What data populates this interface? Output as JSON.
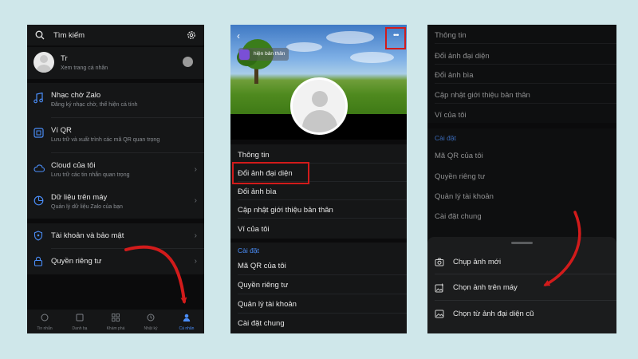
{
  "phone1": {
    "search_label": "Tìm kiếm",
    "profile": {
      "name": "Tr",
      "subtitle": "Xem trang cá nhân"
    },
    "items": [
      {
        "title": "Nhạc chờ Zalo",
        "subtitle": "Đăng ký nhạc chờ, thể hiện cá tính",
        "icon": "music-icon"
      },
      {
        "title": "Ví QR",
        "subtitle": "Lưu trữ và xuất trình các mã QR quan trọng",
        "icon": "qr-wallet-icon"
      },
      {
        "title": "Cloud của tôi",
        "subtitle": "Lưu trữ các tin nhắn quan trọng",
        "icon": "cloud-icon"
      },
      {
        "title": "Dữ liệu trên máy",
        "subtitle": "Quản lý dữ liệu Zalo của bạn",
        "icon": "pie-chart-icon"
      },
      {
        "title": "Tài khoản và bảo mật",
        "icon": "shield-icon"
      },
      {
        "title": "Quyền riêng tư",
        "icon": "lock-icon"
      }
    ],
    "tabs": [
      {
        "label": "Tin nhắn",
        "icon": "chat-icon"
      },
      {
        "label": "Danh bạ",
        "icon": "contacts-icon"
      },
      {
        "label": "Khám phá",
        "icon": "grid-icon"
      },
      {
        "label": "Nhật ký",
        "icon": "clock-icon"
      },
      {
        "label": "Cá nhân",
        "icon": "person-icon",
        "active": true
      }
    ]
  },
  "phone2": {
    "story_label": "hiện bản thân",
    "menu": [
      "Thông tin",
      "Đổi ảnh đại diện",
      "Đổi ảnh bìa",
      "Cập nhật giới thiệu bản thân",
      "Ví của tôi"
    ],
    "settings_header": "Cài đặt",
    "settings": [
      "Mã QR của tôi",
      "Quyền riêng tư",
      "Quản lý tài khoản",
      "Cài đặt chung"
    ]
  },
  "phone3": {
    "menu": [
      "Thông tin",
      "Đổi ảnh đại diện",
      "Đổi ảnh bìa",
      "Cập nhật giới thiệu bản thân",
      "Ví của tôi"
    ],
    "settings_header": "Cài đặt",
    "settings": [
      "Mã QR của tôi",
      "Quyền riêng tư",
      "Quản lý tài khoản",
      "Cài đặt chung"
    ],
    "sheet": [
      {
        "label": "Chụp ảnh mới",
        "icon": "camera-icon"
      },
      {
        "label": "Chọn ảnh trên máy",
        "icon": "gallery-add-icon"
      },
      {
        "label": "Chọn từ ảnh đại diện cũ",
        "icon": "image-icon"
      }
    ]
  },
  "colors": {
    "accent": "#4a8df8",
    "highlight": "#d21b1b",
    "background": "#cfe7ea"
  }
}
